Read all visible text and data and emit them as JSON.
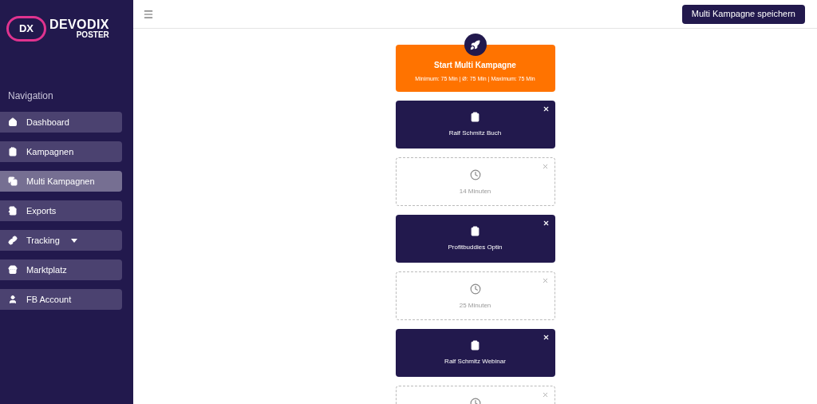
{
  "logo": {
    "mark": "DX",
    "name": "DEVODIX",
    "sub": "POSTER"
  },
  "sidebar": {
    "heading": "Navigation",
    "items": [
      {
        "label": "Dashboard",
        "selected": false
      },
      {
        "label": "Kampagnen",
        "selected": false
      },
      {
        "label": "Multi Kampagnen",
        "selected": true
      },
      {
        "label": "Exports",
        "selected": false
      },
      {
        "label": "Tracking",
        "selected": false,
        "dropdown": true
      },
      {
        "label": "Marktplatz",
        "selected": false
      },
      {
        "label": "FB Account",
        "selected": false
      }
    ]
  },
  "topbar": {
    "save_button": "Multi Kampagne speichern"
  },
  "start": {
    "title": "Start Multi Kampagne",
    "stats": "Minimum: 75 Min | Ø: 75 Min | Maximum: 75 Min"
  },
  "steps": [
    {
      "kind": "campaign",
      "text": "Ralf Schmitz Buch"
    },
    {
      "kind": "wait",
      "text": "14 Minuten"
    },
    {
      "kind": "campaign",
      "text": "Profitbuddies Optin"
    },
    {
      "kind": "wait",
      "text": "25 Minuten"
    },
    {
      "kind": "campaign",
      "text": "Ralf Schmitz Webinar"
    },
    {
      "kind": "wait"
    }
  ]
}
